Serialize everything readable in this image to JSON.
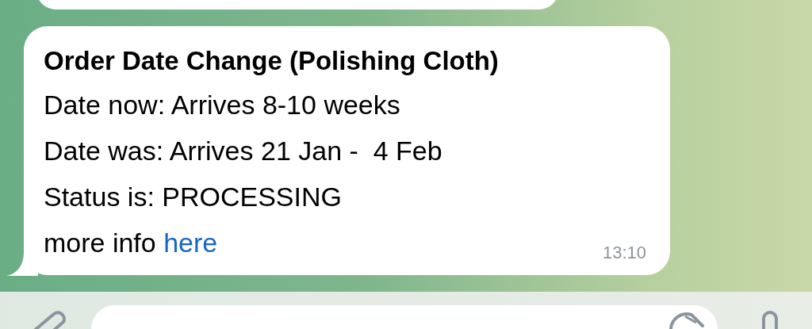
{
  "message": {
    "title": "Order Date Change (Polishing Cloth)",
    "lines": [
      {
        "text": "Date now: Arrives 8-10 weeks"
      },
      {
        "text": "Date was: Arrives 21 Jan -  4 Feb"
      },
      {
        "text": "Status is: PROCESSING"
      },
      {
        "text": "more info ",
        "link": "here"
      }
    ],
    "time": "13:10"
  }
}
